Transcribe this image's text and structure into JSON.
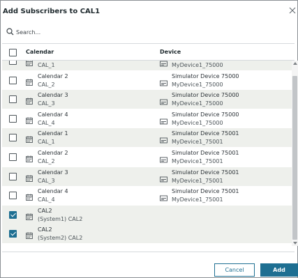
{
  "dialog": {
    "title": "Add Subscribers to CAL1",
    "close_icon": "close-icon"
  },
  "search": {
    "placeholder": "Search...",
    "value": "",
    "icon": "search-icon"
  },
  "table": {
    "columns": {
      "calendar": "Calendar",
      "device": "Device"
    },
    "header_checked": false,
    "rows": [
      {
        "cal_name": "",
        "cal_id": "CAL_1",
        "dev_name": "",
        "dev_id": "MyDevice1_75000",
        "checked": false,
        "alt": true
      },
      {
        "cal_name": "Calendar 2",
        "cal_id": "CAL_2",
        "dev_name": "Simulator Device 75000",
        "dev_id": "MyDevice1_75000",
        "checked": false,
        "alt": false
      },
      {
        "cal_name": "Calendar 3",
        "cal_id": "CAL_3",
        "dev_name": "Simulator Device 75000",
        "dev_id": "MyDevice1_75000",
        "checked": false,
        "alt": true
      },
      {
        "cal_name": "Calendar 4",
        "cal_id": "CAL_4",
        "dev_name": "Simulator Device 75000",
        "dev_id": "MyDevice1_75000",
        "checked": false,
        "alt": false
      },
      {
        "cal_name": "Calendar 1",
        "cal_id": "CAL_1",
        "dev_name": "Simulator Device 75001",
        "dev_id": "MyDevice1_75001",
        "checked": false,
        "alt": true
      },
      {
        "cal_name": "Calendar 2",
        "cal_id": "CAL_2",
        "dev_name": "Simulator Device 75001",
        "dev_id": "MyDevice1_75001",
        "checked": false,
        "alt": false
      },
      {
        "cal_name": "Calendar 3",
        "cal_id": "CAL_3",
        "dev_name": "Simulator Device 75001",
        "dev_id": "MyDevice1_75001",
        "checked": false,
        "alt": true
      },
      {
        "cal_name": "Calendar 4",
        "cal_id": "CAL_4",
        "dev_name": "Simulator Device 75001",
        "dev_id": "MyDevice1_75001",
        "checked": false,
        "alt": false
      },
      {
        "cal_name": "CAL2",
        "cal_id": "(System1) CAL2",
        "dev_name": "",
        "dev_id": "",
        "checked": true,
        "alt": true
      },
      {
        "cal_name": "CAL2",
        "cal_id": "(System2) CAL2",
        "dev_name": "",
        "dev_id": "",
        "checked": true,
        "alt": true
      }
    ]
  },
  "buttons": {
    "cancel": "Cancel",
    "add": "Add"
  },
  "colors": {
    "accent": "#1e6f92",
    "row_alt": "#eef0ec"
  }
}
